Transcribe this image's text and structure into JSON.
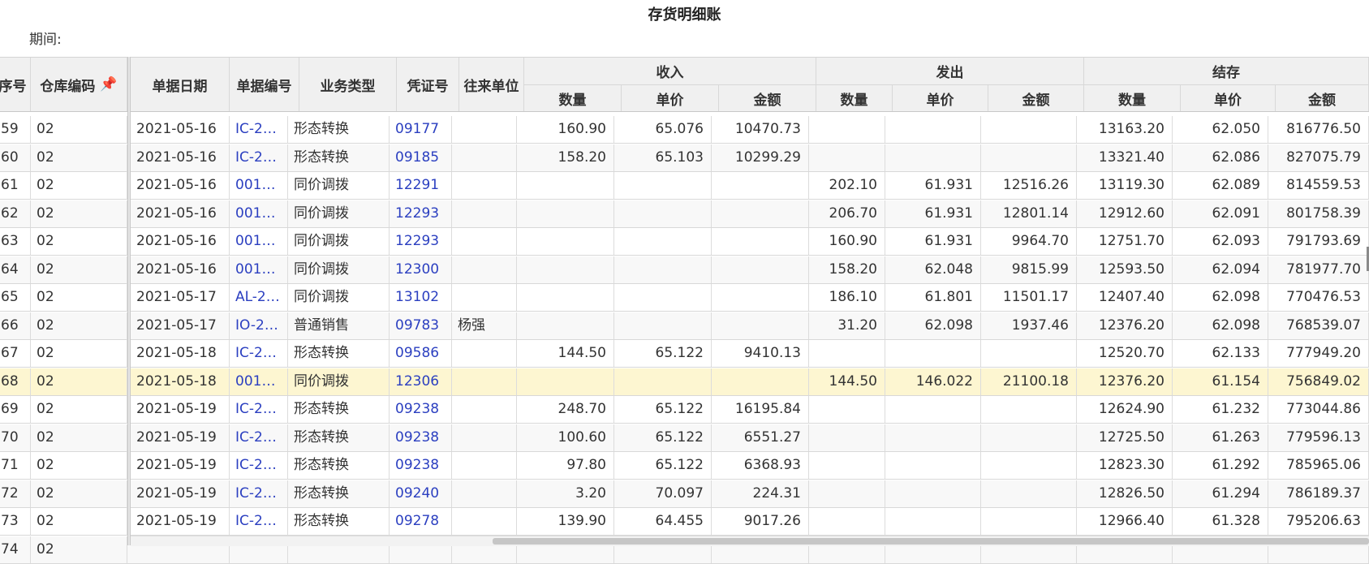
{
  "report": {
    "title": "存货明细账",
    "period_label": "期间:"
  },
  "columns": {
    "seq": "序号",
    "warehouse": "仓库编码",
    "date": "单据日期",
    "doc_no": "单据编号",
    "biz_type": "业务类型",
    "voucher": "凭证号",
    "partner": "往来单位",
    "income": "收入",
    "issue": "发出",
    "balance": "结存",
    "qty": "数量",
    "price": "单价",
    "amount": "金额"
  },
  "rows": [
    {
      "seq": "59",
      "wh": "02",
      "date": "2021-05-16",
      "doc": "IC-2…",
      "type": "形态转换",
      "voucher": "09177",
      "partner": "",
      "in_qty": "160.90",
      "in_price": "65.076",
      "in_amt": "10470.73",
      "out_qty": "",
      "out_price": "",
      "out_amt": "",
      "bal_qty": "13163.20",
      "bal_price": "62.050",
      "bal_amt": "816776.50"
    },
    {
      "seq": "60",
      "wh": "02",
      "date": "2021-05-16",
      "doc": "IC-2…",
      "type": "形态转换",
      "voucher": "09185",
      "partner": "",
      "in_qty": "158.20",
      "in_price": "65.103",
      "in_amt": "10299.29",
      "out_qty": "",
      "out_price": "",
      "out_amt": "",
      "bal_qty": "13321.40",
      "bal_price": "62.086",
      "bal_amt": "827075.79"
    },
    {
      "seq": "61",
      "wh": "02",
      "date": "2021-05-16",
      "doc": "0011…",
      "type": "同价调拨",
      "voucher": "12291",
      "partner": "",
      "in_qty": "",
      "in_price": "",
      "in_amt": "",
      "out_qty": "202.10",
      "out_price": "61.931",
      "out_amt": "12516.26",
      "bal_qty": "13119.30",
      "bal_price": "62.089",
      "bal_amt": "814559.53"
    },
    {
      "seq": "62",
      "wh": "02",
      "date": "2021-05-16",
      "doc": "0011…",
      "type": "同价调拨",
      "voucher": "12293",
      "partner": "",
      "in_qty": "",
      "in_price": "",
      "in_amt": "",
      "out_qty": "206.70",
      "out_price": "61.931",
      "out_amt": "12801.14",
      "bal_qty": "12912.60",
      "bal_price": "62.091",
      "bal_amt": "801758.39"
    },
    {
      "seq": "63",
      "wh": "02",
      "date": "2021-05-16",
      "doc": "0011…",
      "type": "同价调拨",
      "voucher": "12293",
      "partner": "",
      "in_qty": "",
      "in_price": "",
      "in_amt": "",
      "out_qty": "160.90",
      "out_price": "61.931",
      "out_amt": "9964.70",
      "bal_qty": "12751.70",
      "bal_price": "62.093",
      "bal_amt": "791793.69"
    },
    {
      "seq": "64",
      "wh": "02",
      "date": "2021-05-16",
      "doc": "0011…",
      "type": "同价调拨",
      "voucher": "12300",
      "partner": "",
      "in_qty": "",
      "in_price": "",
      "in_amt": "",
      "out_qty": "158.20",
      "out_price": "62.048",
      "out_amt": "9815.99",
      "bal_qty": "12593.50",
      "bal_price": "62.094",
      "bal_amt": "781977.70"
    },
    {
      "seq": "65",
      "wh": "02",
      "date": "2021-05-17",
      "doc": "AL-2…",
      "type": "同价调拨",
      "voucher": "13102",
      "partner": "",
      "in_qty": "",
      "in_price": "",
      "in_amt": "",
      "out_qty": "186.10",
      "out_price": "61.801",
      "out_amt": "11501.17",
      "bal_qty": "12407.40",
      "bal_price": "62.098",
      "bal_amt": "770476.53"
    },
    {
      "seq": "66",
      "wh": "02",
      "date": "2021-05-17",
      "doc": "IO-2…",
      "type": "普通销售",
      "voucher": "09783",
      "partner": "杨强",
      "in_qty": "",
      "in_price": "",
      "in_amt": "",
      "out_qty": "31.20",
      "out_price": "62.098",
      "out_amt": "1937.46",
      "bal_qty": "12376.20",
      "bal_price": "62.098",
      "bal_amt": "768539.07"
    },
    {
      "seq": "67",
      "wh": "02",
      "date": "2021-05-18",
      "doc": "IC-2…",
      "type": "形态转换",
      "voucher": "09586",
      "partner": "",
      "in_qty": "144.50",
      "in_price": "65.122",
      "in_amt": "9410.13",
      "out_qty": "",
      "out_price": "",
      "out_amt": "",
      "bal_qty": "12520.70",
      "bal_price": "62.133",
      "bal_amt": "777949.20"
    },
    {
      "seq": "68",
      "wh": "02",
      "date": "2021-05-18",
      "doc": "0011…",
      "type": "同价调拨",
      "voucher": "12306",
      "partner": "",
      "in_qty": "",
      "in_price": "",
      "in_amt": "",
      "out_qty": "144.50",
      "out_price": "146.022",
      "out_amt": "21100.18",
      "bal_qty": "12376.20",
      "bal_price": "61.154",
      "bal_amt": "756849.02",
      "selected": true
    },
    {
      "seq": "69",
      "wh": "02",
      "date": "2021-05-19",
      "doc": "IC-2…",
      "type": "形态转换",
      "voucher": "09238",
      "partner": "",
      "in_qty": "248.70",
      "in_price": "65.122",
      "in_amt": "16195.84",
      "out_qty": "",
      "out_price": "",
      "out_amt": "",
      "bal_qty": "12624.90",
      "bal_price": "61.232",
      "bal_amt": "773044.86"
    },
    {
      "seq": "70",
      "wh": "02",
      "date": "2021-05-19",
      "doc": "IC-2…",
      "type": "形态转换",
      "voucher": "09238",
      "partner": "",
      "in_qty": "100.60",
      "in_price": "65.122",
      "in_amt": "6551.27",
      "out_qty": "",
      "out_price": "",
      "out_amt": "",
      "bal_qty": "12725.50",
      "bal_price": "61.263",
      "bal_amt": "779596.13"
    },
    {
      "seq": "71",
      "wh": "02",
      "date": "2021-05-19",
      "doc": "IC-2…",
      "type": "形态转换",
      "voucher": "09238",
      "partner": "",
      "in_qty": "97.80",
      "in_price": "65.122",
      "in_amt": "6368.93",
      "out_qty": "",
      "out_price": "",
      "out_amt": "",
      "bal_qty": "12823.30",
      "bal_price": "61.292",
      "bal_amt": "785965.06"
    },
    {
      "seq": "72",
      "wh": "02",
      "date": "2021-05-19",
      "doc": "IC-2…",
      "type": "形态转换",
      "voucher": "09240",
      "partner": "",
      "in_qty": "3.20",
      "in_price": "70.097",
      "in_amt": "224.31",
      "out_qty": "",
      "out_price": "",
      "out_amt": "",
      "bal_qty": "12826.50",
      "bal_price": "61.294",
      "bal_amt": "786189.37"
    },
    {
      "seq": "73",
      "wh": "02",
      "date": "2021-05-19",
      "doc": "IC-2…",
      "type": "形态转换",
      "voucher": "09278",
      "partner": "",
      "in_qty": "139.90",
      "in_price": "64.455",
      "in_amt": "9017.26",
      "out_qty": "",
      "out_price": "",
      "out_amt": "",
      "bal_qty": "12966.40",
      "bal_price": "61.328",
      "bal_amt": "795206.63"
    },
    {
      "seq": "74",
      "wh": "02",
      "date": "",
      "doc": "",
      "type": "",
      "voucher": "",
      "partner": "",
      "in_qty": "",
      "in_price": "",
      "in_amt": "",
      "out_qty": "",
      "out_price": "",
      "out_amt": "",
      "bal_qty": "",
      "bal_price": "",
      "bal_amt": ""
    }
  ]
}
